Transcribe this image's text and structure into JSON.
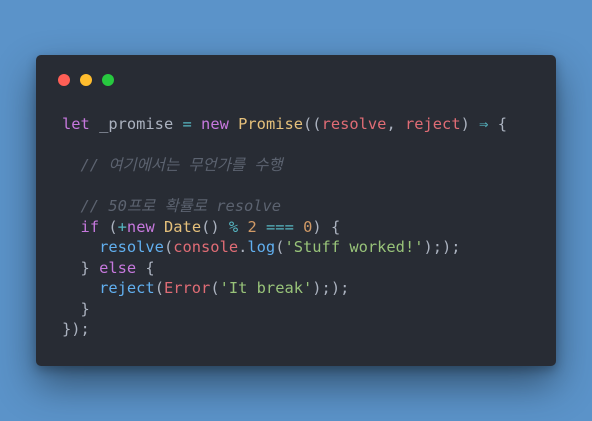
{
  "window": {
    "controls": [
      {
        "name": "close-button",
        "color": "#ff5f56"
      },
      {
        "name": "minimize-button",
        "color": "#ffbd2e"
      },
      {
        "name": "maximize-button",
        "color": "#27c93f"
      }
    ]
  },
  "code": {
    "lines": [
      [
        {
          "t": "let",
          "c": "kw"
        },
        {
          "t": " _promise ",
          "c": "pl"
        },
        {
          "t": "=",
          "c": "op"
        },
        {
          "t": " ",
          "c": "pl"
        },
        {
          "t": "new",
          "c": "kw"
        },
        {
          "t": " ",
          "c": "pl"
        },
        {
          "t": "Promise",
          "c": "cls"
        },
        {
          "t": "((",
          "c": "pl"
        },
        {
          "t": "resolve",
          "c": "prm"
        },
        {
          "t": ", ",
          "c": "pl"
        },
        {
          "t": "reject",
          "c": "prm"
        },
        {
          "t": ") ",
          "c": "pl"
        },
        {
          "t": "⇒",
          "c": "op"
        },
        {
          "t": " {",
          "c": "pl"
        }
      ],
      [],
      [
        {
          "t": "  // 여기에서는 무언가를 수행",
          "c": "cmt"
        }
      ],
      [],
      [
        {
          "t": "  // 50프로 확률로 resolve",
          "c": "cmt"
        }
      ],
      [
        {
          "t": "  ",
          "c": "pl"
        },
        {
          "t": "if",
          "c": "kw"
        },
        {
          "t": " (",
          "c": "pl"
        },
        {
          "t": "+",
          "c": "op"
        },
        {
          "t": "new",
          "c": "kw"
        },
        {
          "t": " ",
          "c": "pl"
        },
        {
          "t": "Date",
          "c": "cls"
        },
        {
          "t": "() ",
          "c": "pl"
        },
        {
          "t": "%",
          "c": "op"
        },
        {
          "t": " ",
          "c": "pl"
        },
        {
          "t": "2",
          "c": "num"
        },
        {
          "t": " ",
          "c": "pl"
        },
        {
          "t": "===",
          "c": "op"
        },
        {
          "t": " ",
          "c": "pl"
        },
        {
          "t": "0",
          "c": "num"
        },
        {
          "t": ") {",
          "c": "pl"
        }
      ],
      [
        {
          "t": "    ",
          "c": "pl"
        },
        {
          "t": "resolve",
          "c": "fn"
        },
        {
          "t": "(",
          "c": "pl"
        },
        {
          "t": "console",
          "c": "prm"
        },
        {
          "t": ".",
          "c": "pl"
        },
        {
          "t": "log",
          "c": "fn"
        },
        {
          "t": "(",
          "c": "pl"
        },
        {
          "t": "'Stuff worked!'",
          "c": "str"
        },
        {
          "t": ");",
          "c": "pl"
        },
        {
          "t": ");",
          "c": "pl"
        }
      ],
      [
        {
          "t": "  } ",
          "c": "pl"
        },
        {
          "t": "else",
          "c": "kw"
        },
        {
          "t": " {",
          "c": "pl"
        }
      ],
      [
        {
          "t": "    ",
          "c": "pl"
        },
        {
          "t": "reject",
          "c": "fn"
        },
        {
          "t": "(",
          "c": "pl"
        },
        {
          "t": "Error",
          "c": "prm"
        },
        {
          "t": "(",
          "c": "pl"
        },
        {
          "t": "'It break'",
          "c": "str"
        },
        {
          "t": ");",
          "c": "pl"
        },
        {
          "t": ");",
          "c": "pl"
        }
      ],
      [
        {
          "t": "  }",
          "c": "pl"
        }
      ],
      [
        {
          "t": "});",
          "c": "pl"
        }
      ]
    ]
  }
}
